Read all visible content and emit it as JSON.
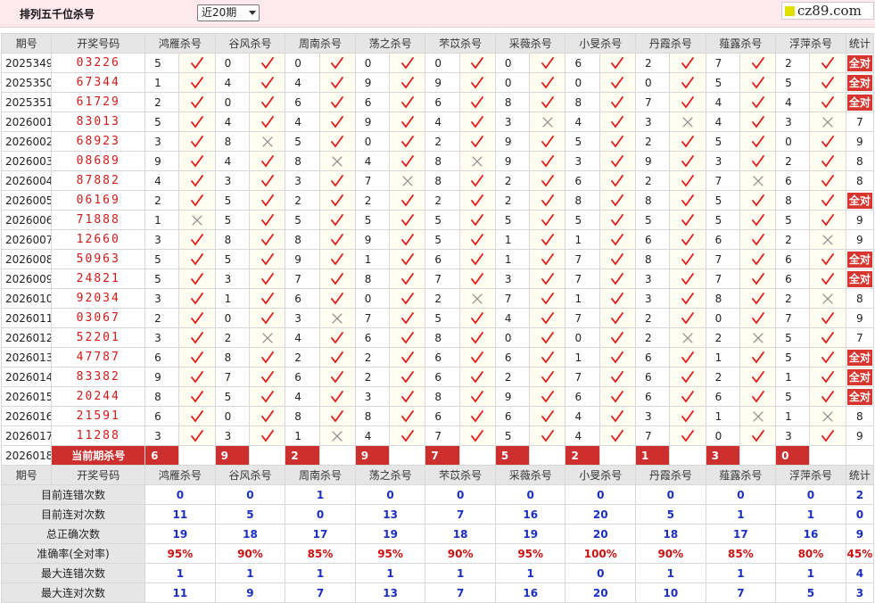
{
  "header": {
    "title": "排列五千位杀号",
    "select_value": "近20期",
    "logo_text": "cz89.com"
  },
  "colors": {
    "accent_red": "#d8352f",
    "check_red": "#e21a1a",
    "cross_gray": "#8a8a8a",
    "stat_blue": "#1a2fc0"
  },
  "columns": {
    "period": "期号",
    "winning": "开奖号码",
    "experts": [
      "鸿雁杀号",
      "谷风杀号",
      "周南杀号",
      "荡之杀号",
      "芣苡杀号",
      "采薇杀号",
      "小旻杀号",
      "丹霞杀号",
      "薤露杀号",
      "浮萍杀号"
    ],
    "stat": "统计"
  },
  "rows": [
    {
      "period": "2025349",
      "numbers": "03226",
      "vals": [
        "5",
        "0",
        "0",
        "0",
        "0",
        "0",
        "6",
        "2",
        "7",
        "2"
      ],
      "marks": [
        1,
        1,
        1,
        1,
        1,
        1,
        1,
        1,
        1,
        1
      ],
      "stat": "全对"
    },
    {
      "period": "2025350",
      "numbers": "67344",
      "vals": [
        "1",
        "4",
        "4",
        "9",
        "9",
        "0",
        "0",
        "0",
        "5",
        "5"
      ],
      "marks": [
        1,
        1,
        1,
        1,
        1,
        1,
        1,
        1,
        1,
        1
      ],
      "stat": "全对"
    },
    {
      "period": "2025351",
      "numbers": "61729",
      "vals": [
        "2",
        "0",
        "6",
        "6",
        "6",
        "8",
        "8",
        "7",
        "4",
        "4"
      ],
      "marks": [
        1,
        1,
        1,
        1,
        1,
        1,
        1,
        1,
        1,
        1
      ],
      "stat": "全对"
    },
    {
      "period": "2026001",
      "numbers": "83013",
      "vals": [
        "5",
        "4",
        "4",
        "9",
        "4",
        "3",
        "4",
        "3",
        "4",
        "3"
      ],
      "marks": [
        1,
        1,
        1,
        1,
        1,
        0,
        1,
        0,
        1,
        0
      ],
      "stat": "7"
    },
    {
      "period": "2026002",
      "numbers": "68923",
      "vals": [
        "3",
        "8",
        "5",
        "0",
        "2",
        "9",
        "5",
        "2",
        "5",
        "0"
      ],
      "marks": [
        1,
        0,
        1,
        1,
        1,
        1,
        1,
        1,
        1,
        1
      ],
      "stat": "9"
    },
    {
      "period": "2026003",
      "numbers": "08689",
      "vals": [
        "9",
        "4",
        "8",
        "4",
        "8",
        "9",
        "3",
        "9",
        "3",
        "2"
      ],
      "marks": [
        1,
        1,
        0,
        1,
        0,
        1,
        1,
        1,
        1,
        1
      ],
      "stat": "8"
    },
    {
      "period": "2026004",
      "numbers": "87882",
      "vals": [
        "4",
        "3",
        "3",
        "7",
        "8",
        "2",
        "6",
        "2",
        "7",
        "6"
      ],
      "marks": [
        1,
        1,
        1,
        0,
        1,
        1,
        1,
        1,
        0,
        1
      ],
      "stat": "8"
    },
    {
      "period": "2026005",
      "numbers": "06169",
      "vals": [
        "2",
        "5",
        "2",
        "2",
        "2",
        "2",
        "8",
        "8",
        "5",
        "8"
      ],
      "marks": [
        1,
        1,
        1,
        1,
        1,
        1,
        1,
        1,
        1,
        1
      ],
      "stat": "全对"
    },
    {
      "period": "2026006",
      "numbers": "71888",
      "vals": [
        "1",
        "5",
        "5",
        "5",
        "5",
        "5",
        "5",
        "5",
        "5",
        "5"
      ],
      "marks": [
        0,
        1,
        1,
        1,
        1,
        1,
        1,
        1,
        1,
        1
      ],
      "stat": "9"
    },
    {
      "period": "2026007",
      "numbers": "12660",
      "vals": [
        "3",
        "8",
        "8",
        "9",
        "5",
        "1",
        "1",
        "6",
        "6",
        "2"
      ],
      "marks": [
        1,
        1,
        1,
        1,
        1,
        1,
        1,
        1,
        1,
        0
      ],
      "stat": "9"
    },
    {
      "period": "2026008",
      "numbers": "50963",
      "vals": [
        "5",
        "5",
        "9",
        "1",
        "6",
        "1",
        "7",
        "8",
        "7",
        "6"
      ],
      "marks": [
        1,
        1,
        1,
        1,
        1,
        1,
        1,
        1,
        1,
        1
      ],
      "stat": "全对"
    },
    {
      "period": "2026009",
      "numbers": "24821",
      "vals": [
        "5",
        "3",
        "7",
        "8",
        "7",
        "3",
        "7",
        "3",
        "7",
        "6"
      ],
      "marks": [
        1,
        1,
        1,
        1,
        1,
        1,
        1,
        1,
        1,
        1
      ],
      "stat": "全对"
    },
    {
      "period": "2026010",
      "numbers": "92034",
      "vals": [
        "3",
        "1",
        "6",
        "0",
        "2",
        "7",
        "1",
        "3",
        "8",
        "2"
      ],
      "marks": [
        1,
        1,
        1,
        1,
        0,
        1,
        1,
        1,
        1,
        0
      ],
      "stat": "8"
    },
    {
      "period": "2026011",
      "numbers": "03067",
      "vals": [
        "2",
        "0",
        "3",
        "7",
        "5",
        "4",
        "7",
        "2",
        "0",
        "7"
      ],
      "marks": [
        1,
        1,
        0,
        1,
        1,
        1,
        1,
        1,
        1,
        1
      ],
      "stat": "9"
    },
    {
      "period": "2026012",
      "numbers": "52201",
      "vals": [
        "3",
        "2",
        "4",
        "6",
        "8",
        "0",
        "0",
        "2",
        "2",
        "5"
      ],
      "marks": [
        1,
        0,
        1,
        1,
        1,
        1,
        1,
        0,
        0,
        1
      ],
      "stat": "7"
    },
    {
      "period": "2026013",
      "numbers": "47787",
      "vals": [
        "6",
        "8",
        "2",
        "2",
        "6",
        "6",
        "1",
        "6",
        "1",
        "5"
      ],
      "marks": [
        1,
        1,
        1,
        1,
        1,
        1,
        1,
        1,
        1,
        1
      ],
      "stat": "全对"
    },
    {
      "period": "2026014",
      "numbers": "83382",
      "vals": [
        "9",
        "7",
        "6",
        "2",
        "6",
        "2",
        "7",
        "6",
        "2",
        "1"
      ],
      "marks": [
        1,
        1,
        1,
        1,
        1,
        1,
        1,
        1,
        1,
        1
      ],
      "stat": "全对"
    },
    {
      "period": "2026015",
      "numbers": "20244",
      "vals": [
        "8",
        "5",
        "4",
        "3",
        "8",
        "9",
        "6",
        "6",
        "6",
        "5"
      ],
      "marks": [
        1,
        1,
        1,
        1,
        1,
        1,
        1,
        1,
        1,
        1
      ],
      "stat": "全对"
    },
    {
      "period": "2026016",
      "numbers": "21591",
      "vals": [
        "6",
        "0",
        "8",
        "8",
        "6",
        "6",
        "4",
        "3",
        "1",
        "1"
      ],
      "marks": [
        1,
        1,
        1,
        1,
        1,
        1,
        1,
        1,
        0,
        0
      ],
      "stat": "8"
    },
    {
      "period": "2026017",
      "numbers": "11288",
      "vals": [
        "3",
        "3",
        "1",
        "4",
        "7",
        "5",
        "4",
        "7",
        "0",
        "3"
      ],
      "marks": [
        1,
        1,
        0,
        1,
        1,
        1,
        1,
        1,
        1,
        1
      ],
      "stat": "9"
    }
  ],
  "current": {
    "period": "2026018",
    "label": "当前期杀号",
    "vals": [
      "6",
      "9",
      "2",
      "9",
      "7",
      "5",
      "2",
      "1",
      "3",
      "0"
    ]
  },
  "stats": [
    {
      "label": "目前连错次数",
      "vals": [
        "0",
        "0",
        "1",
        "0",
        "0",
        "0",
        "0",
        "0",
        "0",
        "0"
      ],
      "total": "2",
      "red": false
    },
    {
      "label": "目前连对次数",
      "vals": [
        "11",
        "5",
        "0",
        "13",
        "7",
        "16",
        "20",
        "5",
        "1",
        "1"
      ],
      "total": "0",
      "red": false
    },
    {
      "label": "总正确次数",
      "vals": [
        "19",
        "18",
        "17",
        "19",
        "18",
        "19",
        "20",
        "18",
        "17",
        "16"
      ],
      "total": "9",
      "red": false
    },
    {
      "label": "准确率(全对率)",
      "vals": [
        "95%",
        "90%",
        "85%",
        "95%",
        "90%",
        "95%",
        "100%",
        "90%",
        "85%",
        "80%"
      ],
      "total": "45%",
      "red": true
    },
    {
      "label": "最大连错次数",
      "vals": [
        "1",
        "1",
        "1",
        "1",
        "1",
        "1",
        "0",
        "1",
        "1",
        "1"
      ],
      "total": "4",
      "red": false
    },
    {
      "label": "最大连对次数",
      "vals": [
        "11",
        "9",
        "7",
        "13",
        "7",
        "16",
        "20",
        "10",
        "7",
        "5"
      ],
      "total": "3",
      "red": false
    }
  ]
}
